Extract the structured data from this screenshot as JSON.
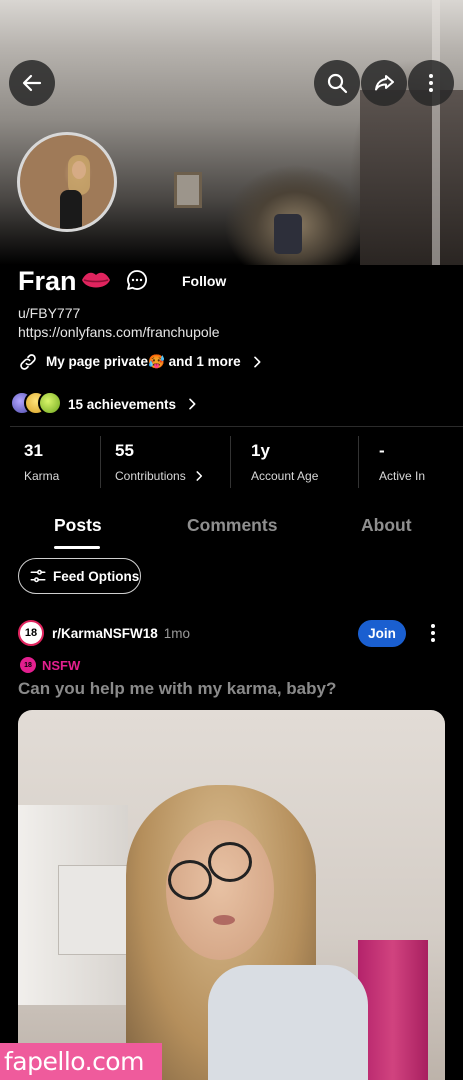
{
  "profile": {
    "display_name": "Fran",
    "follow_label": "Follow",
    "username": "u/FBY777",
    "bio_link": "https://onlyfans.com/franchupole",
    "links_text": "My page private🥵 and 1 more",
    "achievements_text": "15 achievements"
  },
  "stats": [
    {
      "value": "31",
      "label": "Karma"
    },
    {
      "value": "55",
      "label": "Contributions"
    },
    {
      "value": "1y",
      "label": "Account Age"
    },
    {
      "value": "-",
      "label": "Active In"
    }
  ],
  "tabs": [
    {
      "label": "Posts",
      "active": true
    },
    {
      "label": "Comments",
      "active": false
    },
    {
      "label": "About",
      "active": false
    }
  ],
  "feed_options_label": "Feed Options",
  "post": {
    "subreddit": "r/KarmaNSFW18",
    "subreddit_icon_text": "18",
    "time": "1mo",
    "join_label": "Join",
    "nsfw_label": "NSFW",
    "nsfw_icon_text": "18",
    "title": "Can you help me with my karma, baby?"
  },
  "watermark": "fapello.com",
  "icons": {
    "back": "back-arrow-icon",
    "search": "search-icon",
    "share": "share-icon",
    "more": "more-vertical-icon",
    "chat": "chat-icon",
    "link": "link-icon",
    "feed": "sliders-icon"
  },
  "colors": {
    "join_button": "#1a5fd0",
    "nsfw": "#e31f8f",
    "watermark_bg": "#ef5b9c",
    "lips": "#e0245e"
  }
}
